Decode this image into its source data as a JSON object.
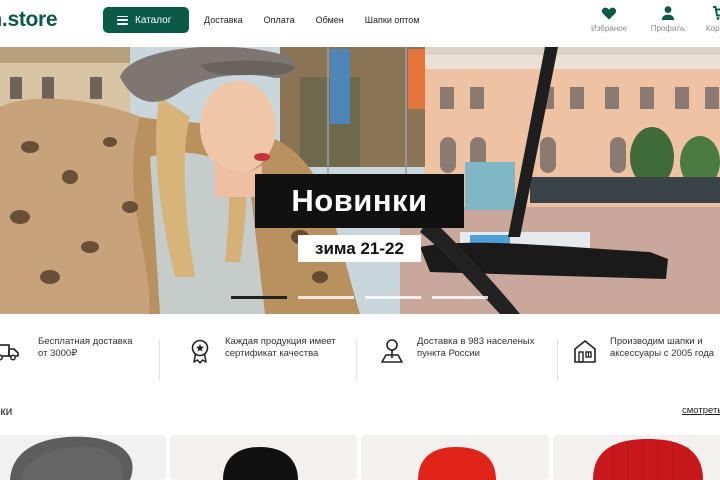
{
  "header": {
    "logo": "ch.store",
    "catalog_label": "Каталог",
    "nav": [
      "Доставка",
      "Оплата",
      "Обмен",
      "Шапки оптом"
    ],
    "icons": [
      {
        "name": "favorites",
        "label": "Избраное",
        "icon": "heart-icon"
      },
      {
        "name": "profile",
        "label": "Профиль",
        "icon": "user-icon"
      },
      {
        "name": "cart",
        "label": "Кор",
        "icon": "cart-icon"
      }
    ],
    "accent": "#0b5a47"
  },
  "hero": {
    "title": "Новинки",
    "subtitle": "зима 21-22",
    "slides": 4,
    "active_slide": 1
  },
  "features": [
    {
      "icon": "truck-icon",
      "text": [
        "Бесплатная доставка",
        "от 3000₽"
      ]
    },
    {
      "icon": "certificate-icon",
      "text": [
        "Каждая продукция имеет",
        "сертификат качества"
      ]
    },
    {
      "icon": "map-pin-icon",
      "text": [
        "Доставка в 983 населеных",
        "пункта России"
      ]
    },
    {
      "icon": "factory-icon",
      "text": [
        "Производим шапки и",
        "аксессуары с 2005 года"
      ]
    }
  ],
  "new_section": {
    "title": "инки",
    "see_all": "смотреть все",
    "products": [
      {
        "color": "#5a5a5a"
      },
      {
        "color": "#111111"
      },
      {
        "color": "#e0241a"
      },
      {
        "color": "#c8181c"
      }
    ]
  }
}
